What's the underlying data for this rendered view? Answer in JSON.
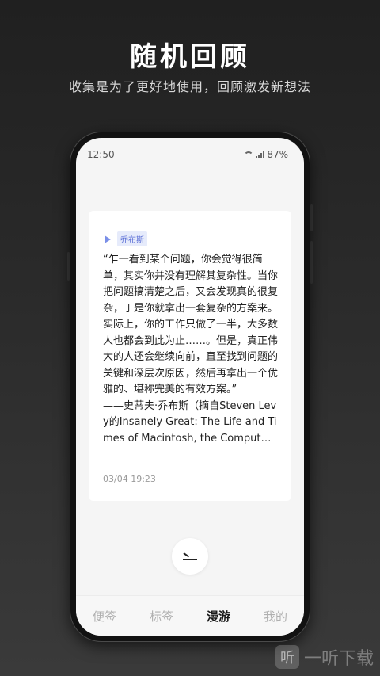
{
  "hero": {
    "title": "随机回顾",
    "subtitle": "收集是为了更好地使用，回顾激发新想法"
  },
  "status_bar": {
    "time": "12:50",
    "battery": "87%"
  },
  "card": {
    "tag_icon": "play-icon",
    "tag": "乔布斯",
    "quote": "“乍一看到某个问题，你会觉得很简单，其实你并没有理解其复杂性。当你把问题搞清楚之后，又会发现真的很复杂，于是你就拿出一套复杂的方案来。实际上，你的工作只做了一半，大多数人也都会到此为止……。但是，真正伟大的人还会继续向前，直至找到问题的关键和深层次原因，然后再拿出一个优雅的、堪称完美的有效方案。”\n——史蒂夫·乔布斯（摘自Steven Levy的Insanely Great: The Life and Times of Macintosh, the Comput…",
    "date": "03/04 19:23"
  },
  "back_button": {
    "icon": "back-arrow-icon"
  },
  "tabs": [
    {
      "label": "便签",
      "active": false
    },
    {
      "label": "标签",
      "active": false
    },
    {
      "label": "漫游",
      "active": true
    },
    {
      "label": "我的",
      "active": false
    }
  ],
  "watermark": {
    "logo": "听",
    "text": "一听下载"
  },
  "colors": {
    "accent": "#5b6fd6",
    "tag_bg": "#e6ebfb",
    "background_top": "#202020",
    "background_bottom": "#3a3a3a"
  }
}
